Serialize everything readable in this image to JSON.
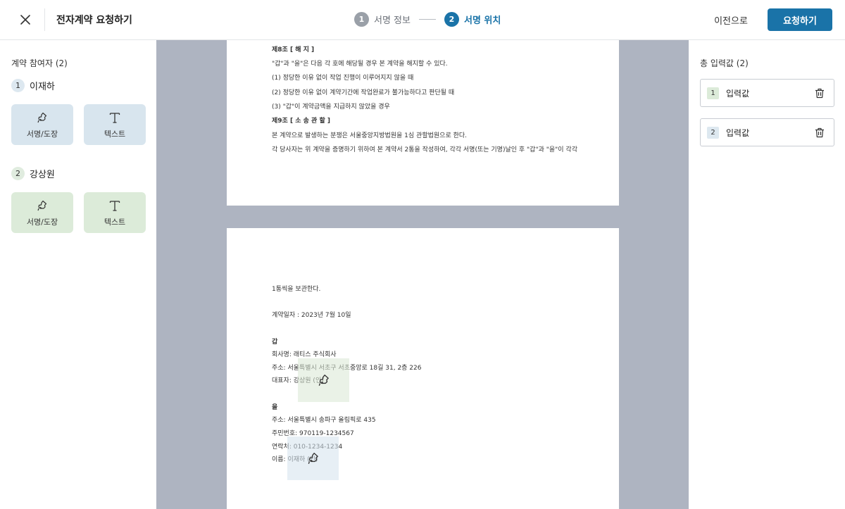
{
  "header": {
    "title": "전자계약 요청하기",
    "steps": [
      {
        "num": "1",
        "label": "서명 정보"
      },
      {
        "num": "2",
        "label": "서명 위치"
      }
    ],
    "prev_label": "이전으로",
    "request_label": "요청하기"
  },
  "left": {
    "section_title": "계약 참여자 (2)",
    "participants": [
      {
        "num": "1",
        "name": "이재하",
        "tools": [
          {
            "label": "서명/도장",
            "icon": "stamp-icon"
          },
          {
            "label": "텍스트",
            "icon": "text-icon"
          }
        ]
      },
      {
        "num": "2",
        "name": "강상원",
        "tools": [
          {
            "label": "서명/도장",
            "icon": "stamp-icon"
          },
          {
            "label": "텍스트",
            "icon": "text-icon"
          }
        ]
      }
    ]
  },
  "document": {
    "page1": [
      "제8조 [ 해 지 ]",
      "\"갑\"과 \"을\"은 다음 각 호에 해당될 경우 본 계약을 해지할 수 있다.",
      "(1) 정당한 이유 없이 작업 진행이 이루어지지 않을 때",
      "(2) 정당한 이유 없이 계약기간에 작업완료가 불가능하다고 판단될 때",
      "(3) \"갑\"이 계약금액을 지급하지 않았을 경우",
      "제9조 [ 소 송 관 할 ]",
      "본 계약으로 발생하는 분쟁은 서울중앙지방법원을 1심 관할법원으로 한다.",
      "각 당사자는 위 계약을 증명하기 위하여 본 계약서 2통을 작성하여, 각각 서명(또는 기명)날인 후 \"갑\"과 \"을\"이 각각"
    ],
    "page2": [
      "1통씩을 보관한다.",
      "계약일자 :  2023년 7월 10일",
      "갑",
      "회사명: 래티스 주식회사",
      "주소: 서울특별시 서초구 서초중앙로 18길 31, 2층 226",
      "대표자: 강상원 (인)",
      "을",
      "주소: 서울특별시 송파구 올림픽로 435",
      "주민번호: 970119-1234567",
      "연락처: 010-1234-1234",
      "이름: 이재하 (인)"
    ]
  },
  "right": {
    "title": "총 입력값 (2)",
    "items": [
      {
        "num": "1",
        "label": "입력값"
      },
      {
        "num": "2",
        "label": "입력값"
      }
    ]
  },
  "colors": {
    "primary": "#1a73a8",
    "participant_1": "#d8e5ee",
    "participant_2": "#dcebd9",
    "viewer_bg": "#aeb4c1"
  }
}
